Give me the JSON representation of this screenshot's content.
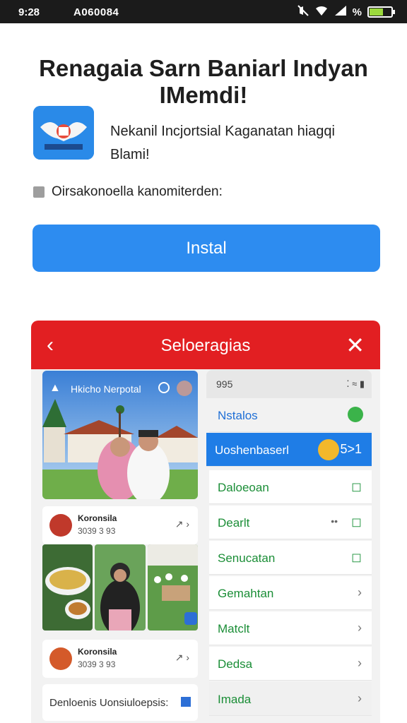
{
  "status_bar": {
    "time": "9:28",
    "carrier": "A060084",
    "icons": [
      "mute-icon",
      "wifi-icon",
      "signal-icon",
      "percent-icon",
      "battery-icon"
    ],
    "percent": "%"
  },
  "app": {
    "title_line1": "Renagaia Sarn Baniarl Indyan",
    "title_line2": "IMemdi!",
    "description": "Nekanil Incjortsial Kaganatan hiagqi Blami!",
    "checkbox_label": "Oirsakonoella kanomiterden:",
    "install_label": "Instal"
  },
  "panel": {
    "title": "Seloeragias",
    "photo_caption": "Hkicho Nerpotal",
    "posts": [
      {
        "name": "Koronsila",
        "meta": "3039 3 93"
      },
      {
        "name": "Koronsila",
        "meta": "3039 3 93"
      }
    ],
    "search_text": "Denloenis Uonsiuloepsis:",
    "settings_status_time": "995",
    "settings_items": [
      {
        "label": "Nstalos",
        "icon": "whatsapp-icon"
      },
      {
        "label": "Uoshenbaserl",
        "icon": "app-badge-icon",
        "extra": "5>1"
      },
      {
        "label": "Daloeoan",
        "icon": "bookmark-icon"
      },
      {
        "label": "Dearlt",
        "icon": "bookmark-icon",
        "extra": "••"
      },
      {
        "label": "Senucatan",
        "icon": "bookmark-icon"
      },
      {
        "label": "Gemahtan",
        "icon": "chevron-icon"
      },
      {
        "label": "Matclt",
        "icon": "chevron-icon"
      },
      {
        "label": "Dedsa",
        "icon": "chevron-icon"
      },
      {
        "label": "Imada",
        "icon": "chevron-icon"
      }
    ]
  },
  "colors": {
    "status_bar": "#1b1b1b",
    "install_button": "#2d8cf0",
    "panel_header": "#e21f22",
    "highlight_row": "#1f7de6",
    "row_text": "#1b8e37"
  }
}
